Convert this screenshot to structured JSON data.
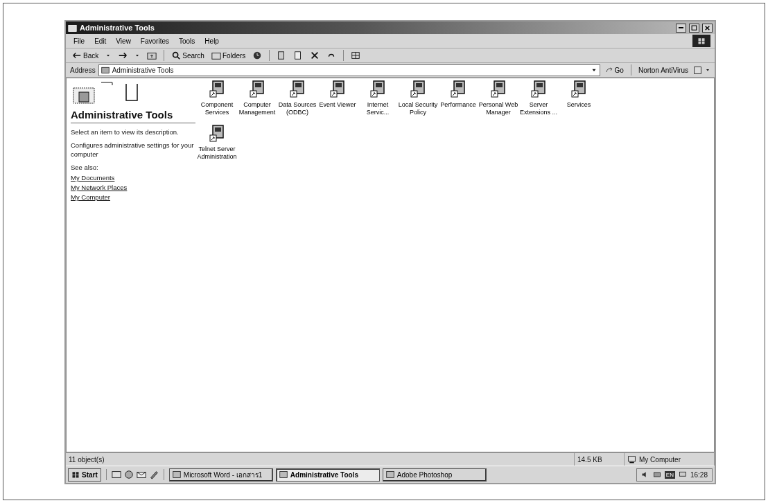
{
  "window": {
    "title": "Administrative Tools"
  },
  "menu": [
    "File",
    "Edit",
    "View",
    "Favorites",
    "Tools",
    "Help"
  ],
  "toolbar": {
    "back": "Back",
    "search": "Search",
    "folders": "Folders"
  },
  "address": {
    "label": "Address",
    "value": "Administrative Tools",
    "go": "Go",
    "norton": "Norton AntiVirus"
  },
  "panel": {
    "heading": "Administrative Tools",
    "hint": "Select an item to view its description.",
    "description": "Configures administrative settings for your computer",
    "see_also": "See also:",
    "links": [
      "My Documents",
      "My Network Places",
      "My Computer"
    ]
  },
  "items": [
    {
      "label": "Component Services"
    },
    {
      "label": "Computer Management"
    },
    {
      "label": "Data Sources (ODBC)"
    },
    {
      "label": "Event Viewer"
    },
    {
      "label": "Internet Servic..."
    },
    {
      "label": "Local Security Policy"
    },
    {
      "label": "Performance"
    },
    {
      "label": "Personal Web Manager"
    },
    {
      "label": "Server Extensions ..."
    },
    {
      "label": "Services"
    },
    {
      "label": "Telnet Server Administration"
    }
  ],
  "status_bar": {
    "objects": "11 object(s)",
    "size": "14.5 KB",
    "zone": "My Computer"
  },
  "taskbar": {
    "start": "Start",
    "tasks": [
      {
        "label": "Microsoft Word - เอกสาร1",
        "selected": false
      },
      {
        "label": "Administrative Tools",
        "selected": true
      },
      {
        "label": "Adobe Photoshop",
        "selected": false
      }
    ],
    "language": "EN",
    "clock": "16:28"
  }
}
